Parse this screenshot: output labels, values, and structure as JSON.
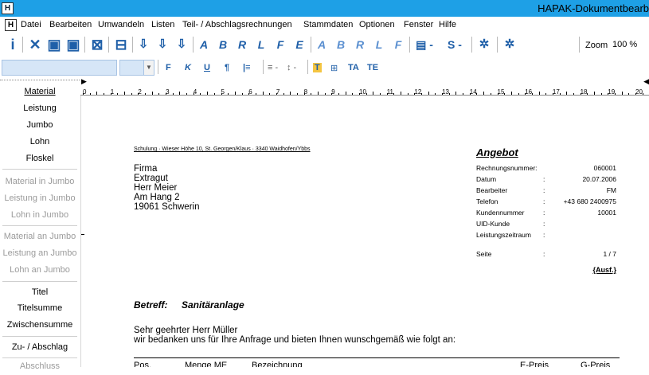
{
  "window": {
    "title": "HAPAK-Dokumentbearb",
    "app_icon": "H"
  },
  "menu": {
    "icon": "H",
    "items": [
      "Datei",
      "Bearbeiten",
      "Umwandeln",
      "Listen",
      "Teil- / Abschlagsrechnungen",
      "Stammdaten",
      "Optionen",
      "Fenster",
      "Hilfe"
    ]
  },
  "toolbar": {
    "icons": [
      "info-icon",
      "delete-icon",
      "save-icon",
      "save-all-icon",
      "cancel-icon",
      "print-icon",
      "import-icon",
      "export-icon",
      "export2-icon",
      "doc-a-icon",
      "doc-b-icon",
      "doc-r-icon",
      "doc-l-icon",
      "doc-f-icon",
      "doc-e-icon",
      "page-a-icon",
      "page-b-icon",
      "page-r-icon",
      "page-l-icon",
      "page-f-icon",
      "page-dropdown-icon",
      "page-s-dropdown-icon",
      "gear-icon",
      "gear-page-icon"
    ],
    "zoom_label": "Zoom",
    "zoom_value": "100 %"
  },
  "format": {
    "font_value": "",
    "size_value": "",
    "bold": "F",
    "italic": "K",
    "underline": "U",
    "paragraph": "¶",
    "indent": "|≡",
    "align": "≡ -",
    "spacing": "↕ -",
    "text_color": "T",
    "border": "⊞",
    "font_a": "TA",
    "font_e": "TE"
  },
  "sidebar": {
    "items": [
      {
        "label": "Material",
        "enabled": true
      },
      {
        "label": "Leistung",
        "enabled": true
      },
      {
        "label": "Jumbo",
        "enabled": true
      },
      {
        "label": "Lohn",
        "enabled": true
      },
      {
        "label": "Floskel",
        "enabled": true
      },
      {
        "label": "Material in Jumbo",
        "enabled": false
      },
      {
        "label": "Leistung in Jumbo",
        "enabled": false
      },
      {
        "label": "Lohn in Jumbo",
        "enabled": false
      },
      {
        "label": "Material an Jumbo",
        "enabled": false
      },
      {
        "label": "Leistung an Jumbo",
        "enabled": false
      },
      {
        "label": "Lohn an Jumbo",
        "enabled": false
      },
      {
        "label": "Titel",
        "enabled": true
      },
      {
        "label": "Titelsumme",
        "enabled": true
      },
      {
        "label": "Zwischensumme",
        "enabled": true
      },
      {
        "label": "Zu- / Abschlag",
        "enabled": true
      },
      {
        "label": "Abschluss",
        "enabled": false
      }
    ]
  },
  "ruler": {
    "numbers": [
      "0",
      "1",
      "2",
      "3",
      "4",
      "5",
      "6",
      "7",
      "8",
      "9",
      "10",
      "11",
      "12",
      "13",
      "14",
      "15",
      "16",
      "17",
      "18",
      "19",
      "20"
    ]
  },
  "document": {
    "sender_line": "Schulung · Wieser Höhe 10, St. Georgen/Klaus · 3340 Waidhofen/Ybbs",
    "address": [
      "Firma",
      "Extragut",
      "Herr Meier",
      "Am Hang 2",
      "19061 Schwerin"
    ],
    "doc_title": "Angebot",
    "info": [
      {
        "label": "Rechnungsnummer:",
        "colon": "",
        "value": "060001"
      },
      {
        "label": "Datum",
        "colon": ":",
        "value": "20.07.2006"
      },
      {
        "label": "Bearbeiter",
        "colon": ":",
        "value": "FM"
      },
      {
        "label": "Telefon",
        "colon": ":",
        "value": "+43 680 2400975"
      },
      {
        "label": "Kundennummer",
        "colon": ":",
        "value": "10001"
      },
      {
        "label": "UID-Kunde",
        "colon": ":",
        "value": ""
      },
      {
        "label": "Leistungszeitraum",
        "colon": ":",
        "value": ""
      }
    ],
    "page": {
      "label": "Seite",
      "colon": ":",
      "value": "1 / 7"
    },
    "ausf": "{Ausf.}",
    "subject_label": "Betreff:",
    "subject_value": "Sanitäranlage",
    "salutation": "Sehr geehrter Herr Müller",
    "intro": "wir bedanken uns für Ihre Anfrage  und bieten Ihnen wunschgemäß wie folgt an:",
    "table_headers": [
      "Pos.",
      "Menge ME",
      "Bezeichnung",
      "E-Preis",
      "G-Preis"
    ]
  }
}
